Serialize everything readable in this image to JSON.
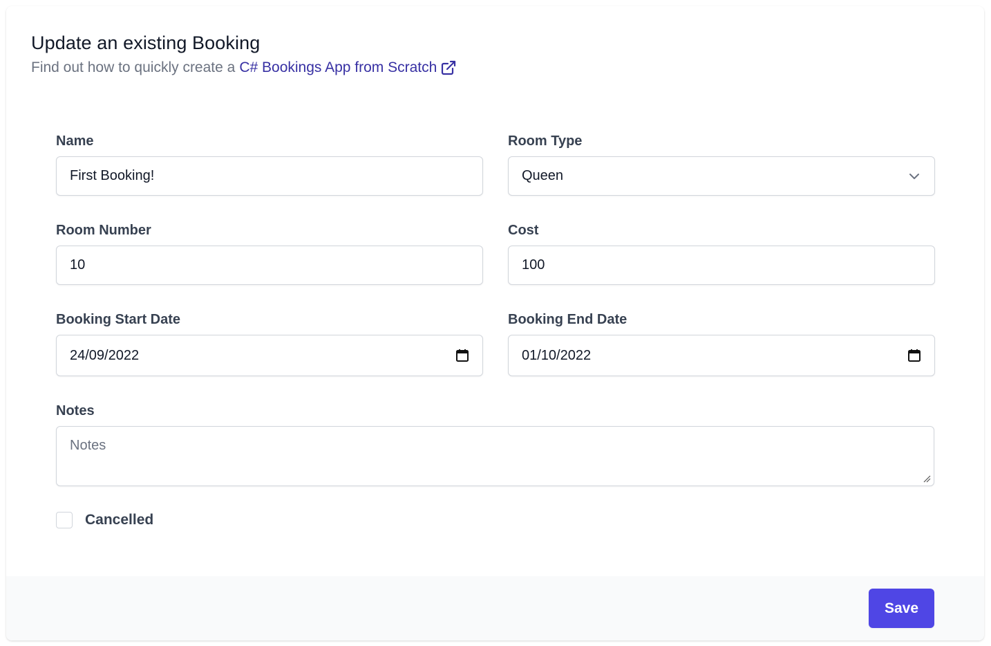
{
  "header": {
    "title": "Update an existing Booking",
    "subtitle_prefix": "Find out how to quickly create a",
    "link_text": "C# Bookings App from Scratch"
  },
  "form": {
    "name": {
      "label": "Name",
      "value": "First Booking!"
    },
    "room_type": {
      "label": "Room Type",
      "value": "Queen"
    },
    "room_number": {
      "label": "Room Number",
      "value": "10"
    },
    "cost": {
      "label": "Cost",
      "value": "100"
    },
    "start_date": {
      "label": "Booking Start Date",
      "value": "24/09/2022"
    },
    "end_date": {
      "label": "Booking End Date",
      "value": "01/10/2022"
    },
    "notes": {
      "label": "Notes",
      "placeholder": "Notes",
      "value": ""
    },
    "cancelled": {
      "label": "Cancelled",
      "checked": false
    }
  },
  "footer": {
    "save_label": "Save"
  },
  "colors": {
    "accent": "#4f46e5",
    "link": "#3730a3",
    "footer_bg": "#f9fafb"
  },
  "icons": {
    "link": "external-link-icon",
    "select": "chevron-down-icon",
    "date": "calendar-icon",
    "textarea": "resize-handle-icon"
  }
}
